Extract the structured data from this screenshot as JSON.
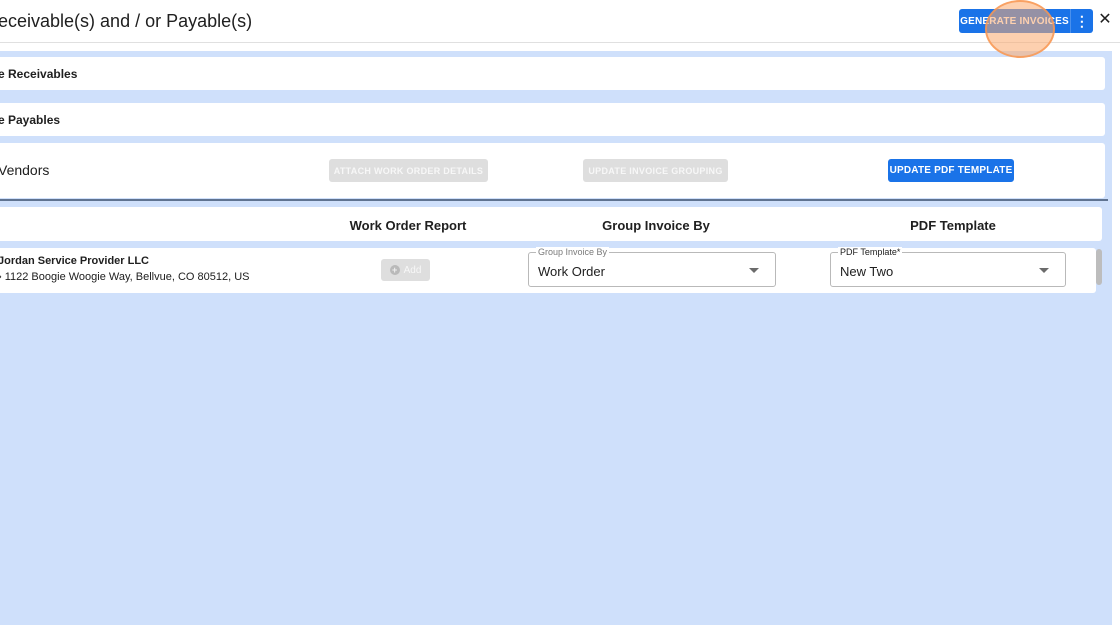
{
  "header": {
    "title": "eceivable(s) and / or Payable(s)",
    "generate_label": "GENERATE INVOICES",
    "more_glyph": "⋮",
    "close_glyph": "✕"
  },
  "sections": {
    "receivables_label": "e Receivables",
    "payables_label": "e Payables"
  },
  "vendors": {
    "title": "Vendors",
    "attach_label": "ATTACH WORK ORDER DETAILS",
    "grouping_label": "UPDATE INVOICE GROUPING",
    "update_pdf_label": "UPDATE PDF TEMPLATE"
  },
  "table": {
    "columns": [
      "Work Order Report",
      "Group Invoice By",
      "PDF Template"
    ],
    "rows": [
      {
        "vendor_name": "Jordan Service Provider LLC",
        "address": "› 1122 Boogie Woogie Way, Bellvue, CO 80512, US",
        "add_label": "Add",
        "group_by_legend": "Group Invoice By",
        "group_by_value": "Work Order",
        "pdf_legend": "PDF Template*",
        "pdf_value": "New Two"
      }
    ]
  },
  "colors": {
    "primary": "#1a73e8",
    "background": "#cfe0fb",
    "disabled": "#dedede"
  },
  "icons": [
    "more-vertical-icon",
    "close-icon",
    "add-circle-icon",
    "dropdown-caret-icon"
  ]
}
